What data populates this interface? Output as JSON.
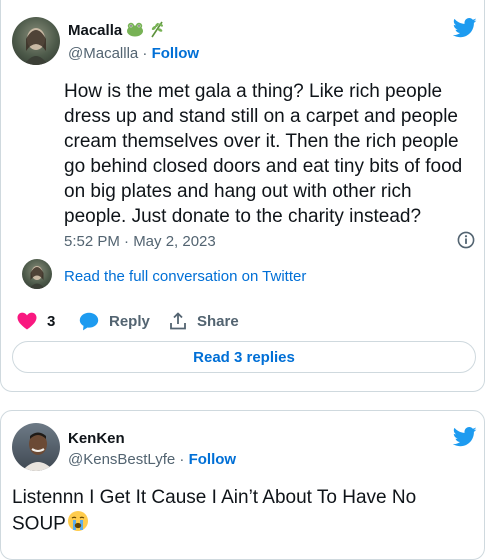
{
  "tweet1": {
    "author_name": "Macalla",
    "author_handle": "@Macallla",
    "follow_label": "Follow",
    "text": "How is the met gala a thing? Like rich people dress up and stand still on a carpet and people cream themselves over it. Then the rich people go behind closed doors and eat tiny bits of food on big plates and hang out with other rich people. Just donate to the charity instead?",
    "timestamp": "5:52 PM · May 2, 2023",
    "conversation_link": "Read the full conversation on Twitter",
    "like_count": "3",
    "reply_label": "Reply",
    "share_label": "Share",
    "read_replies_label": "Read 3 replies"
  },
  "tweet2": {
    "author_name": "KenKen",
    "author_handle": "@KensBestLyfe",
    "follow_label": "Follow",
    "text": "Listennn  I Get It Cause I Ain’t About To Have No SOUP"
  },
  "colors": {
    "twitter_blue": "#1d9bf0",
    "link_blue": "#006fd6",
    "like_pink": "#f91880",
    "text": "#0f1419",
    "muted": "#536471",
    "border": "#cfd9de"
  },
  "icons": [
    "frog-icon",
    "herb-icon",
    "twitter-bird-icon",
    "info-icon",
    "heart-icon",
    "reply-bubble-icon",
    "share-icon",
    "crying-face-icon"
  ]
}
